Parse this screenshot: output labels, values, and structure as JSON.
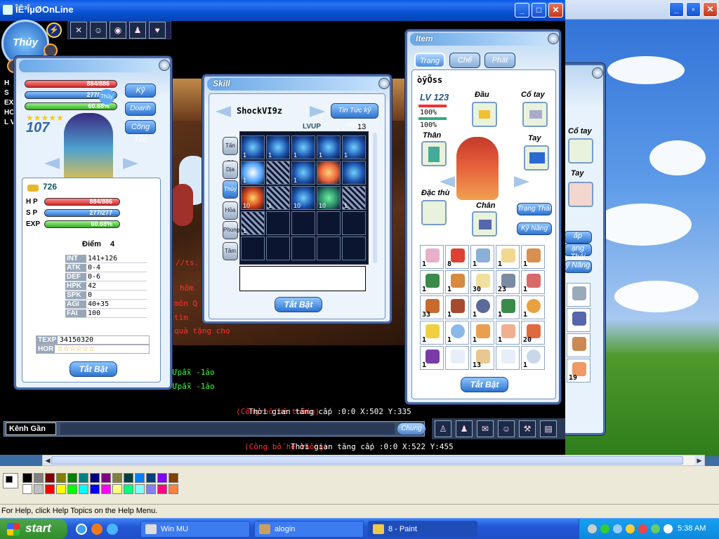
{
  "game": {
    "title": "ÎÊ³ÎµØOnLine",
    "player_name_badge": "Thủy"
  },
  "char_panel": {
    "hp_top": "884/886",
    "sp_top": "277/277",
    "exp_top": "60.68%",
    "side_letters": [
      "H",
      "S",
      "EXP",
      "HOR",
      "L V"
    ],
    "level": "107",
    "buttons": [
      "Kỹ Năng",
      "Doanh Trại",
      "Công Tác"
    ],
    "gold": "726",
    "hp_label": "H P",
    "hp": "884/886",
    "sp_label": "S P",
    "sp": "277/277",
    "exp_label": "EXP",
    "exp": "60.68%",
    "points_label": "Điểm",
    "points": "4",
    "stats": [
      {
        "k": "INT",
        "v": "141+126"
      },
      {
        "k": "ATK",
        "v": "0-4"
      },
      {
        "k": "DEF",
        "v": "0-6"
      },
      {
        "k": "HPK",
        "v": "42"
      },
      {
        "k": "SPK",
        "v": "0"
      },
      {
        "k": "AGI",
        "v": "40+35"
      },
      {
        "k": "FAI",
        "v": "100"
      }
    ],
    "texp_label": "TEXP",
    "texp": "34150320",
    "hor_label": "HOR",
    "hor_stars": "☆☆☆☆☆☆",
    "toggle": "Tắt Bật"
  },
  "skill_panel": {
    "title": "Skill",
    "name": "ShockVI9z",
    "info_btn": "Tin Tức kỹ năng",
    "lvup_label": "LVUP",
    "lvup": "13",
    "tabs": [
      "Tấn Cộ",
      "Dịa",
      "Thủy",
      "Hỏa",
      "Phong",
      "Tâm"
    ],
    "levels": [
      "1",
      "1",
      "1",
      "1",
      "1",
      "1",
      "1",
      "10",
      "1",
      "10",
      "10",
      "1",
      "1"
    ],
    "toggle": "Tắt Bật"
  },
  "item_panel": {
    "title": "Item",
    "tabs": [
      "Trang Bị",
      "Chế Tạo",
      "Phát"
    ],
    "name": "òỹÕss",
    "lv_label": "LV",
    "lv": "123",
    "pct1": "100%",
    "pct2": "100%",
    "slots": [
      "Đầu",
      "Cổ tay",
      "Thân",
      "Tay",
      "Đặc thù",
      "Chân"
    ],
    "side_btns": [
      "Trạng Thái",
      "Kỹ Năng"
    ],
    "quantities": [
      "1",
      "8",
      "1",
      "1",
      "1",
      "1",
      "1",
      "30",
      "23",
      "1",
      "33",
      "1",
      "1",
      "1",
      "1",
      "1",
      "1",
      "1",
      "1",
      "20",
      "1",
      "",
      "13",
      "",
      "1"
    ],
    "toggle": "Tắt Bật"
  },
  "item_panel_back": {
    "slots": [
      "Cổ tay",
      "Tay"
    ],
    "btns": [
      "ấp",
      "ạng Thái",
      "ỹ Năng"
    ],
    "quantities": [
      "1",
      "",
      "",
      "19"
    ]
  },
  "chat": {
    "lines": [
      {
        "t": "//ts.",
        "c": "#ff3030"
      },
      {
        "t": "hôm",
        "c": "#ff3030"
      },
      {
        "t": "môn Q",
        "c": "#ff3030"
      },
      {
        "t": "tìm",
        "c": "#ff3030"
      },
      {
        "t": "quà tặng cho",
        "c": "#ff3030"
      },
      {
        "t": "Ưpẫx -1ảo",
        "c": "#3cff3c"
      },
      {
        "t": "Ưpẫx -1ảo",
        "c": "#3cff3c"
      }
    ],
    "status1": "(Công bố hệ thống)",
    "time1": "Thời gian tăng cấp :0:0 X:502 Y:335",
    "status2": "(Công bố hệ thống)",
    "time2": "Thời gian tăng cấp :0:0 X:522 Y:455",
    "channel": "Kênh Gần",
    "chung": "Chung"
  },
  "paint": {
    "status": "For Help, click Help Topics on the Help Menu."
  },
  "taskbar": {
    "start": "start",
    "tasks": [
      "Win MU",
      "alogin",
      "8 - Paint"
    ],
    "clock": "5:38 AM"
  }
}
